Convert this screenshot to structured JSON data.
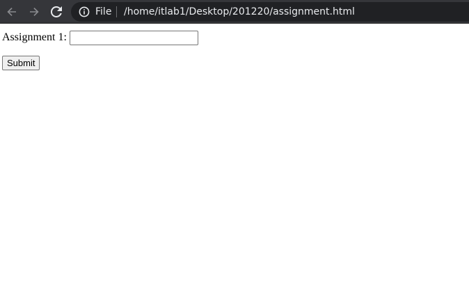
{
  "browser": {
    "address_bar": {
      "scheme_label": "File",
      "url": "/home/itlab1/Desktop/201220/assignment.html"
    },
    "icons": {
      "back": "arrow-left-icon",
      "forward": "arrow-right-icon",
      "reload": "reload-icon",
      "site_info": "info-icon"
    },
    "colors": {
      "toolbar_bg": "#35363a",
      "omnibox_bg": "#202124",
      "toolbar_text": "#e8eaed"
    }
  },
  "page": {
    "form": {
      "assignment_label": "Assignment 1:",
      "assignment_value": "",
      "submit_label": "Submit"
    }
  }
}
